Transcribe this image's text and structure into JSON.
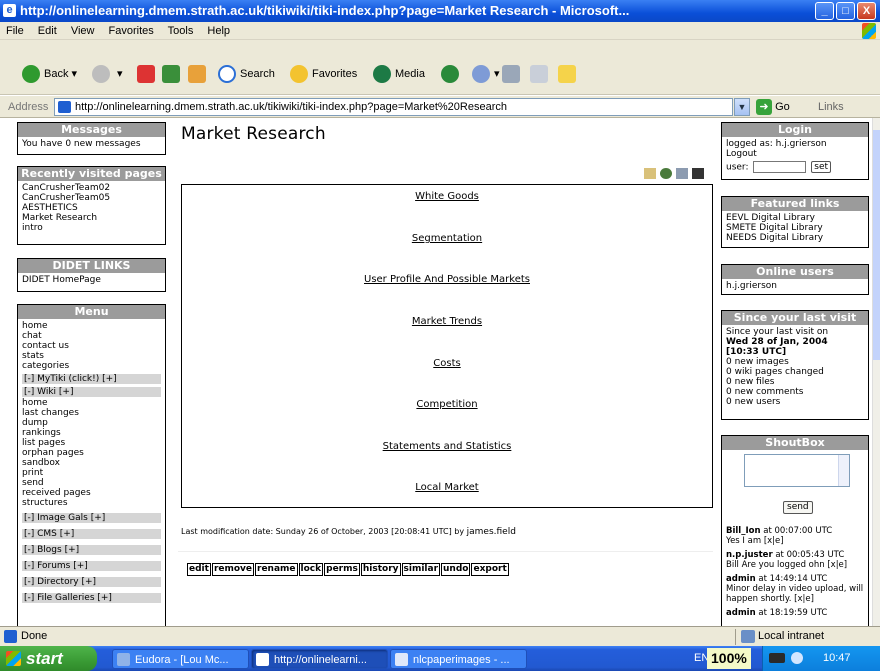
{
  "window": {
    "title": "http://onlinelearning.dmem.strath.ac.uk/tikiwiki/tiki-index.php?page=Market Research - Microsoft...",
    "min": "_",
    "max": "□",
    "close": "X"
  },
  "menubar": [
    "File",
    "Edit",
    "View",
    "Favorites",
    "Tools",
    "Help"
  ],
  "toolbar": {
    "back": "Back",
    "search": "Search",
    "favorites": "Favorites",
    "media": "Media"
  },
  "address": {
    "label": "Address",
    "url": "http://onlinelearning.dmem.strath.ac.uk/tikiwiki/tiki-index.php?page=Market%20Research",
    "go": "Go",
    "links": "Links"
  },
  "left": {
    "messages": {
      "title": "Messages",
      "text": "You have 0 new messages"
    },
    "recent": {
      "title": "Recently visited pages",
      "items": [
        "CanCrusherTeam02",
        "CanCrusherTeam05",
        "AESTHETICS",
        "Market Research",
        "intro"
      ]
    },
    "didet": {
      "title": "DIDET LINKS",
      "items": [
        "DIDET HomePage"
      ]
    },
    "menu": {
      "title": "Menu",
      "top_items": [
        "home",
        "chat",
        "contact us",
        "stats",
        "categories"
      ],
      "mytiki": "[-] MyTiki (click!) [+]",
      "wiki": "[-] Wiki [+]",
      "wiki_items": [
        "home",
        "last changes",
        "dump",
        "rankings",
        "list pages",
        "orphan pages",
        "sandbox",
        "print",
        "send",
        "received pages",
        "structures"
      ],
      "sections": [
        "[-] Image Gals [+]",
        "[-] CMS [+]",
        "[-] Blogs [+]",
        "[-] Forums [+]",
        "[-] Directory [+]",
        "[-] File Galleries [+]"
      ]
    }
  },
  "main": {
    "title": "Market Research",
    "links": [
      "White Goods",
      "Segmentation",
      "User Profile And Possible Markets",
      "Market Trends",
      "Costs",
      "Competition",
      "Statements and Statistics",
      "Local Market"
    ],
    "lastmod_label": "Last modification date: Sunday 26 of October, 2003 [20:08:41 UTC] by",
    "lastmod_user": "james.field",
    "actions": [
      "edit",
      "remove",
      "rename",
      "lock",
      "perms",
      "history",
      "similar",
      "undo",
      "export"
    ]
  },
  "right": {
    "login": {
      "title": "Login",
      "logged": "logged as: h.j.grierson",
      "logout": "Logout",
      "user_label": "user:",
      "set": "set"
    },
    "featured": {
      "title": "Featured links",
      "items": [
        "EEVL Digital Library",
        "SMETE Digital Library",
        "NEEDS Digital Library"
      ]
    },
    "online": {
      "title": "Online users",
      "items": [
        "h.j.grierson"
      ]
    },
    "since": {
      "title": "Since your last visit",
      "intro": "Since your last visit on",
      "date": "Wed 28 of Jan, 2004",
      "time": "[10:33 UTC]",
      "items": [
        "0 new images",
        "0 wiki pages changed",
        "0 new files",
        "0 new comments",
        "0 new users"
      ]
    },
    "shoutbox": {
      "title": "ShoutBox",
      "send": "send",
      "messages": [
        {
          "user": "Bill_Ion",
          "when": "at 00:07:00 UTC",
          "text": "Yes I am [x|e]"
        },
        {
          "user": "n.p.juster",
          "when": "at 00:05:43 UTC",
          "text": "Bill Are you logged ohn [x|e]"
        },
        {
          "user": "admin",
          "when": "at 14:49:14 UTC",
          "text": "Minor delay in video upload, will happen shortly. [x|e]"
        },
        {
          "user": "admin",
          "when": "at 18:19:59 UTC",
          "text": ""
        }
      ]
    }
  },
  "status": {
    "text": "Done",
    "zone": "Local intranet"
  },
  "taskbar": {
    "start": "start",
    "tasks": [
      "Eudora - [Lou Mc...",
      "http://onlinelearni...",
      "nlcpaperimages - ..."
    ],
    "lang": "EN",
    "zoom": "100%",
    "clock": "10:47"
  }
}
